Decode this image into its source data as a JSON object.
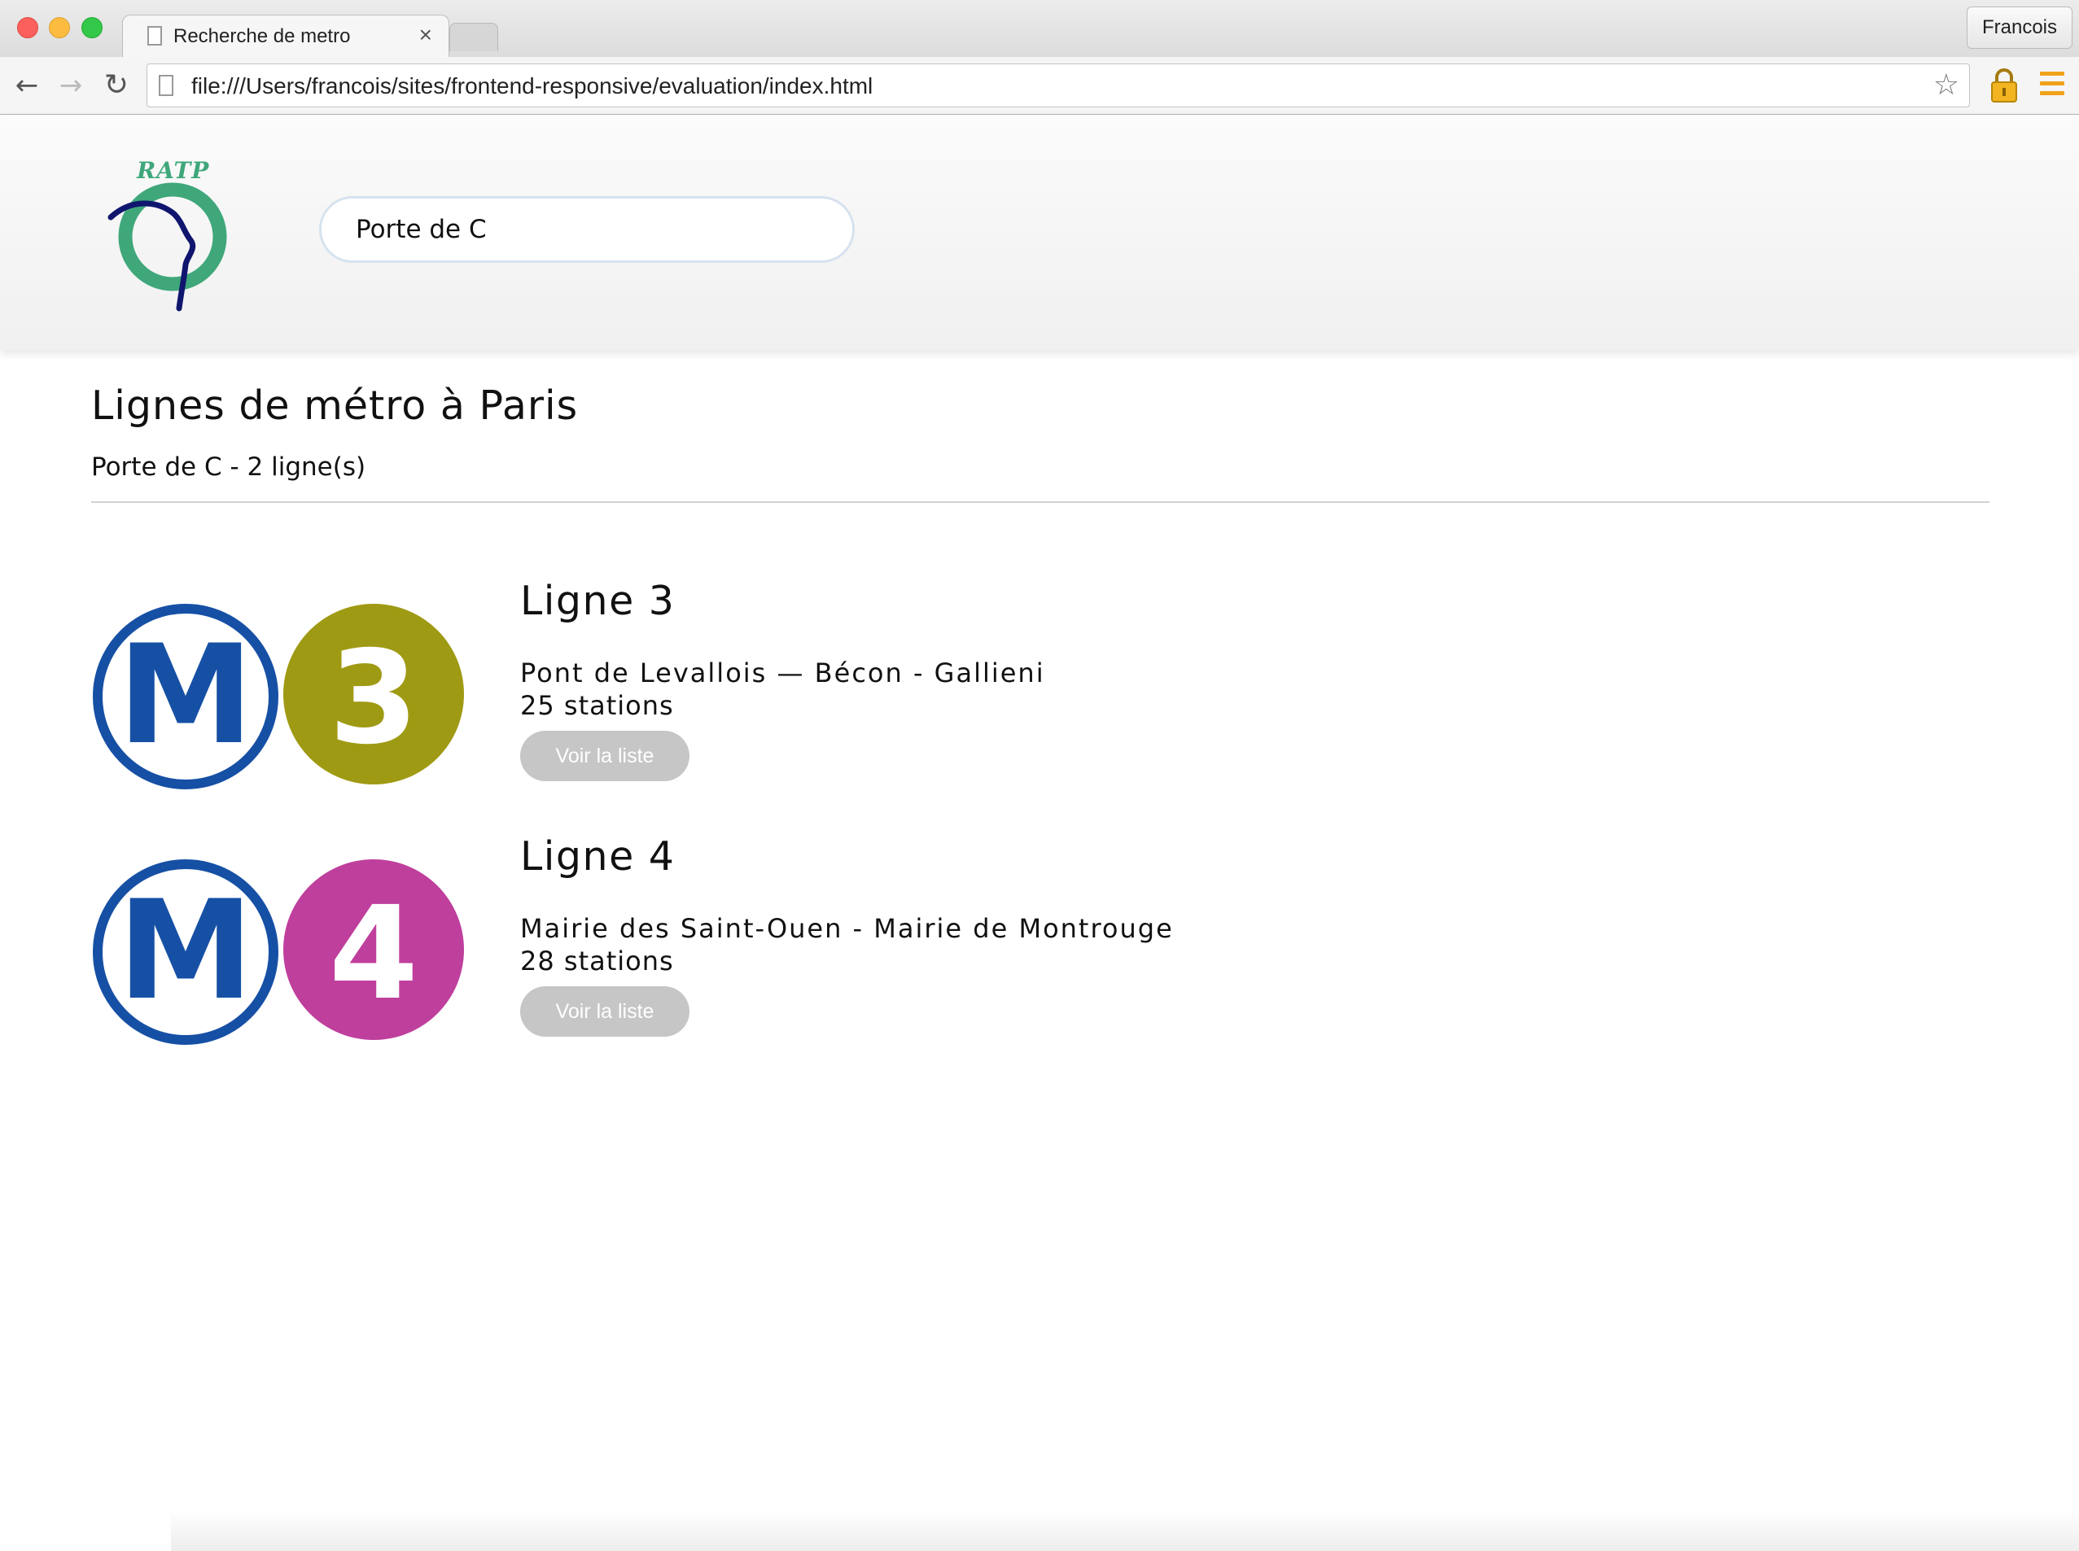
{
  "browser": {
    "tab_title": "Recherche de metro",
    "tab_close": "×",
    "profile_name": "Francois",
    "url": "file:///Users/francois/sites/frontend-responsive/evaluation/index.html"
  },
  "header": {
    "logo_text": "RATP",
    "search_value": "Porte de C"
  },
  "main": {
    "title": "Lignes de métro à Paris",
    "summary": "Porte de C - 2 ligne(s)",
    "lines": [
      {
        "number": "3",
        "color": "#9f9a13",
        "title": "Ligne 3",
        "route": "Pont de Levallois — Bécon - Gallieni",
        "stations": "25 stations",
        "button": "Voir la liste"
      },
      {
        "number": "4",
        "color": "#bf3f9d",
        "title": "Ligne 4",
        "route": "Mairie des Saint-Ouen - Mairie de Montrouge",
        "stations": "28 stations",
        "button": "Voir la liste"
      }
    ]
  },
  "colors": {
    "metro_blue": "#1650a5",
    "ratp_green": "#3fa77a",
    "ratp_navy": "#10166e",
    "button_grey": "#c6c6c6"
  }
}
